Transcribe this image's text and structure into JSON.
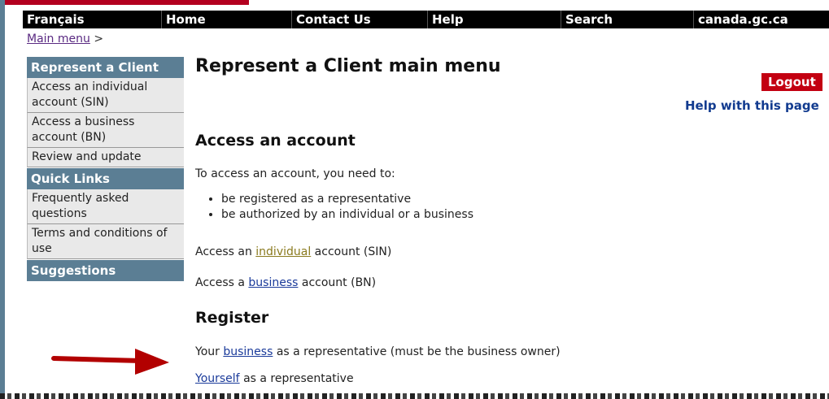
{
  "nav": {
    "items": [
      "Français",
      "Home",
      "Contact Us",
      "Help",
      "Search",
      "canada.gc.ca"
    ]
  },
  "breadcrumb": {
    "link": "Main menu",
    "sep": ">"
  },
  "sidebar": {
    "section1": {
      "header": "Represent a Client",
      "items": [
        "Access an individual account (SIN)",
        "Access a business account (BN)",
        "Review and update"
      ]
    },
    "section2": {
      "header": "Quick Links",
      "items": [
        "Frequently asked questions",
        "Terms and conditions of use"
      ]
    },
    "section3": {
      "header": "Suggestions"
    }
  },
  "main": {
    "title": "Represent a Client main menu",
    "logout": "Logout",
    "help": "Help with this page",
    "access": {
      "heading": "Access an account",
      "intro": "To access an account, you need to:",
      "bullets": [
        "be registered as a representative",
        "be authorized by an individual or a business"
      ],
      "line1": {
        "pre": "Access an ",
        "link": "individual",
        "post": " account (SIN)"
      },
      "line2": {
        "pre": "Access a ",
        "link": "business",
        "post": " account (BN)"
      }
    },
    "register": {
      "heading": "Register",
      "line1": {
        "pre": "Your ",
        "link": "business",
        "post": " as a representative (must be the business owner)"
      },
      "line2": {
        "link": "Yourself",
        "post": " as a representative"
      }
    }
  },
  "colors": {
    "nav_bg": "#000000",
    "sidebar_header": "#5b7e94",
    "logout": "#c30011",
    "arrow": "#b20000"
  }
}
